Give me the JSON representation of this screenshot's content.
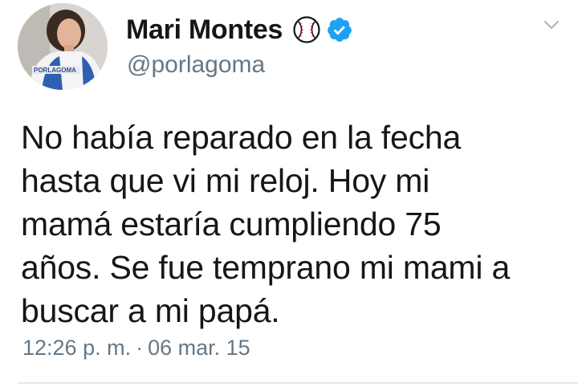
{
  "tweet": {
    "author": {
      "display_name": "Mari Montes",
      "handle": "@porlagoma",
      "avatar_jersey_text": "PORLAGOMA",
      "badge_icons": [
        "baseball-icon",
        "verified-icon"
      ]
    },
    "text": "No había reparado en la fecha\nhasta que vi mi reloj. Hoy mi\nmamá estaría cumpliendo 75\naños. Se fue temprano mi mami a\nbuscar a mi papá.",
    "time": "12:26 p. m.",
    "separator": "·",
    "date": "06 mar. 15"
  },
  "colors": {
    "text": "#14171a",
    "secondary": "#657786",
    "verified_blue": "#1da1f2",
    "divider": "#e1e8ed"
  }
}
